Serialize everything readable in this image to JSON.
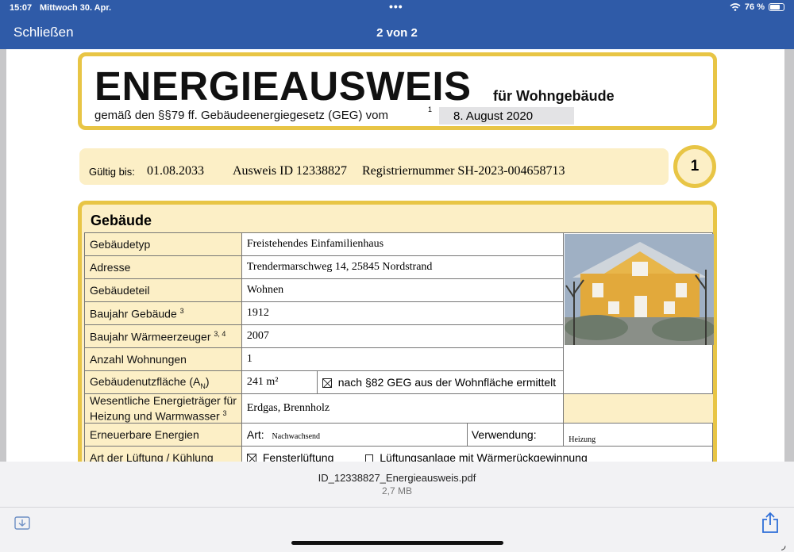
{
  "status": {
    "time": "15:07",
    "date": "Mittwoch 30. Apr.",
    "battery": "76 %"
  },
  "nav": {
    "close_label": "Schließen",
    "title": "2 von 2"
  },
  "doc": {
    "heading": "ENERGIEAUSWEIS",
    "heading_suffix": "für Wohngebäude",
    "law_text": "gemäß den §§79 ff. Gebäudeenergiegesetz (GEG) vom",
    "footnote": "1",
    "law_date": "8. August 2020",
    "valid_label": "Gültig bis:",
    "valid_value": "01.08.2033",
    "ausweis_id": "Ausweis ID 12338827",
    "registry": "Registriernummer  SH-2023-004658713",
    "page_number": "1",
    "section_title": "Gebäude",
    "rows": {
      "gebaeudetyp": {
        "label": "Gebäudetyp",
        "value": "Freistehendes Einfamilienhaus"
      },
      "adresse": {
        "label": "Adresse",
        "value": "Trendermarschweg 14, 25845 Nordstrand"
      },
      "gebaeudeteil": {
        "label": "Gebäudeteil",
        "value": "Wohnen"
      },
      "baujahr": {
        "label": "Baujahr Gebäude",
        "sup": "3",
        "value": "1912"
      },
      "baujahr_wz": {
        "label": "Baujahr Wärmeerzeuger",
        "sup": "3, 4",
        "value": "2007"
      },
      "wohnungen": {
        "label": "Anzahl Wohnungen",
        "value": "1"
      },
      "nutzflaeche": {
        "label": "Gebäudenutzfläche (A",
        "sub": "N",
        "label_end": ")",
        "value": "241 m²",
        "option": "nach §82 GEG aus der Wohnfläche ermittelt"
      },
      "energietraeger": {
        "label_line1": "Wesentliche Energieträger für",
        "label_line2": "Heizung und Warmwasser",
        "sup": "3",
        "value": "Erdgas, Brennholz"
      },
      "erneuerbar": {
        "label": "Erneuerbare Energien",
        "art_label": "Art:",
        "art_value": "Nachwachsend",
        "verwendung_label": "Verwendung:",
        "verwendung_value": "Heizung"
      },
      "lueftung": {
        "label": "Art der Lüftung / Kühlung",
        "opt1": "Fensterlüftung",
        "opt2": "Lüftungsanlage mit Wärmerückgewinnung"
      }
    }
  },
  "file": {
    "name": "ID_12338827_Energieausweis.pdf",
    "size": "2,7 MB"
  }
}
